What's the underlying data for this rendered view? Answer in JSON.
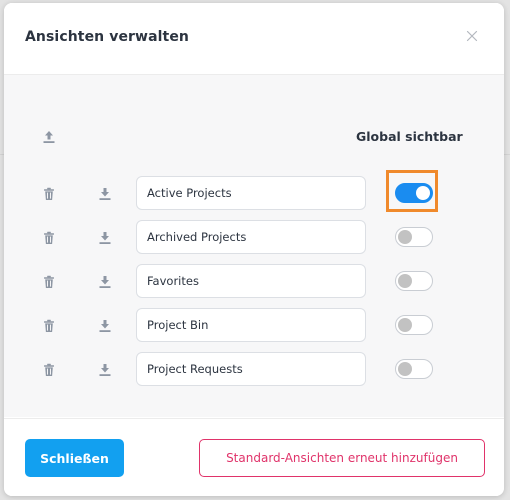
{
  "dialog": {
    "title": "Ansichten verwalten"
  },
  "table": {
    "global_visible_header": "Global sichtbar"
  },
  "views": [
    {
      "name": "Active Projects",
      "global_visible": true,
      "highlighted": true
    },
    {
      "name": "Archived Projects",
      "global_visible": false,
      "highlighted": false
    },
    {
      "name": "Favorites",
      "global_visible": false,
      "highlighted": false
    },
    {
      "name": "Project Bin",
      "global_visible": false,
      "highlighted": false
    },
    {
      "name": "Project Requests",
      "global_visible": false,
      "highlighted": false
    }
  ],
  "footer": {
    "close_label": "Schließen",
    "restore_label": "Standard-Ansichten erneut hinzufügen"
  },
  "icons": {
    "close": "close-icon",
    "upload": "upload-icon",
    "delete": "trash-icon",
    "download": "download-icon"
  },
  "colors": {
    "primary": "#12a0f0",
    "toggle_on": "#1a8cf0",
    "danger": "#e0336a",
    "highlight": "#f08a2c"
  }
}
